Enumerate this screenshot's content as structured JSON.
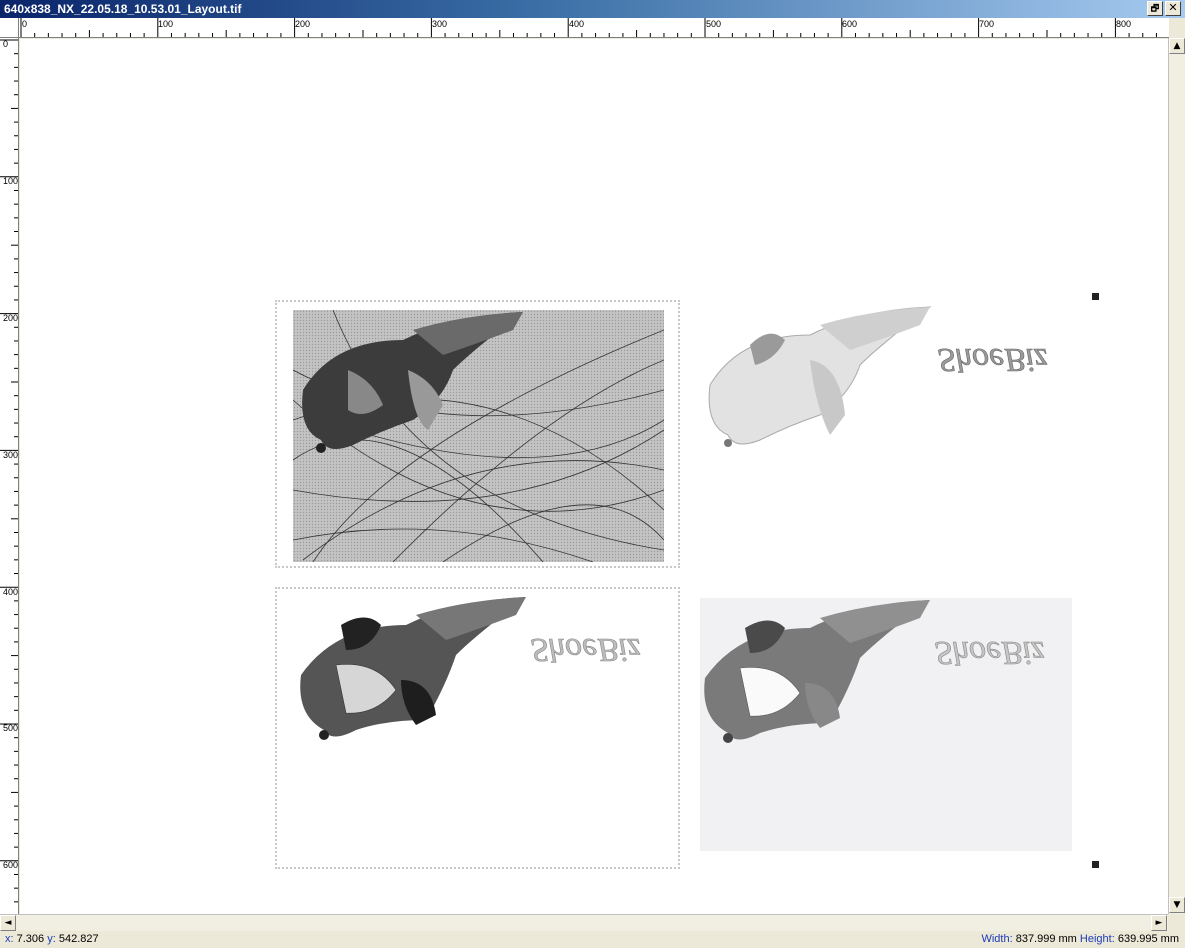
{
  "window": {
    "title": "640x838_NX_22.05.18_10.53.01_Layout.tif"
  },
  "title_buttons": {
    "restore": "🗗",
    "close": "✕"
  },
  "ruler_h": {
    "labels": [
      "0",
      "100",
      "200",
      "300",
      "400",
      "500",
      "600",
      "700",
      "800"
    ]
  },
  "ruler_v": {
    "labels": [
      "0",
      "100",
      "200",
      "300",
      "400",
      "500",
      "600"
    ]
  },
  "images": {
    "watermark_text": "ShoeBiz"
  },
  "status": {
    "x_label": "x:",
    "x_value": "7.306",
    "y_label": "y:",
    "y_value": "542.827",
    "width_label": "Width:",
    "width_value": "837.999 mm",
    "height_label": "Height:",
    "height_value": "639.995 mm"
  },
  "scroll": {
    "up": "▲",
    "down": "▼",
    "left": "◄",
    "right": "►"
  }
}
